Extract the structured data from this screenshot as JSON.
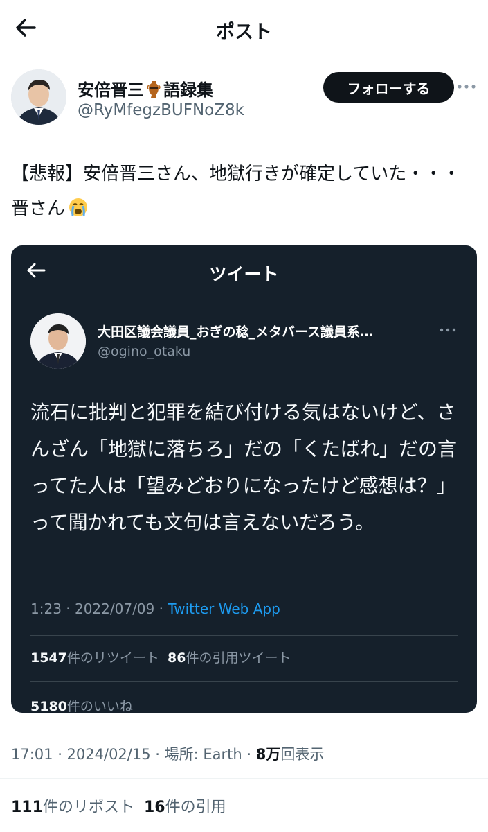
{
  "header": {
    "title": "ポスト"
  },
  "author": {
    "name": "安倍晋三",
    "name_suffix": "語録集",
    "handle": "@RyMfegzBUFNoZ8k",
    "follow_label": "フォローする"
  },
  "post": {
    "text": "【悲報】安倍晋三さん、地獄行きが確定していた・・・晋さん"
  },
  "embedded": {
    "title": "ツイート",
    "name": "大田区議会議員_おぎの稔_メタバース議員系…",
    "handle": "@ogino_otaku",
    "body": "流石に批判と犯罪を結び付ける気はないけど、さんざん「地獄に落ちろ」だの「くたばれ」だの言ってた人は「望みどおりになったけど感想は？」って聞かれても文句は言えないだろう。",
    "time": "1:23 · 2022/07/09 · ",
    "source": "Twitter Web App",
    "retweet_count": "1547",
    "retweet_label": "件のリツイート",
    "quote_count": "86",
    "quote_label": "件の引用ツイート",
    "like_count": "5180",
    "like_label": "件のいいね"
  },
  "meta": {
    "time": "17:01 · 2024/02/15 · 場所: Earth · ",
    "views_count": "8万",
    "views_label": "回表示"
  },
  "stats": {
    "repost_count": "111",
    "repost_label": "件のリポスト",
    "quote_count": "16",
    "quote_label": "件の引用"
  },
  "colors": {
    "accent": "#1d9bf0",
    "dark_bg": "#15202b",
    "text_primary": "#0f1419",
    "text_secondary": "#536471"
  },
  "icons": [
    "back-arrow-icon",
    "amphora-icon",
    "more-icon",
    "crying-face-icon"
  ]
}
